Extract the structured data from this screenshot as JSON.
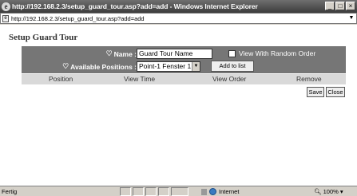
{
  "window": {
    "title": "http://192.168.2.3/setup_guard_tour.asp?add=add - Windows Internet Explorer",
    "buttons": [
      "_",
      "□",
      "×"
    ]
  },
  "address_bar": {
    "url": "http://192.168.2.3/setup_guard_tour.asp?add=add"
  },
  "page": {
    "title": "Setup Guard Tour",
    "form": {
      "name_label": "Name :",
      "name_value": "Guard Tour Name",
      "random_order_label": "View With Random Order",
      "random_order_checked": false,
      "positions_label": "Available Positions :",
      "positions_selected": "Point-1  Fenster 1",
      "add_button": "Add to list"
    },
    "table_headers": [
      "Position",
      "View Time",
      "View Order",
      "Remove"
    ],
    "save_button": "Save",
    "close_button": "Close"
  },
  "status_bar": {
    "text": "Fertig",
    "zone": "Internet",
    "zoom": "100%"
  }
}
